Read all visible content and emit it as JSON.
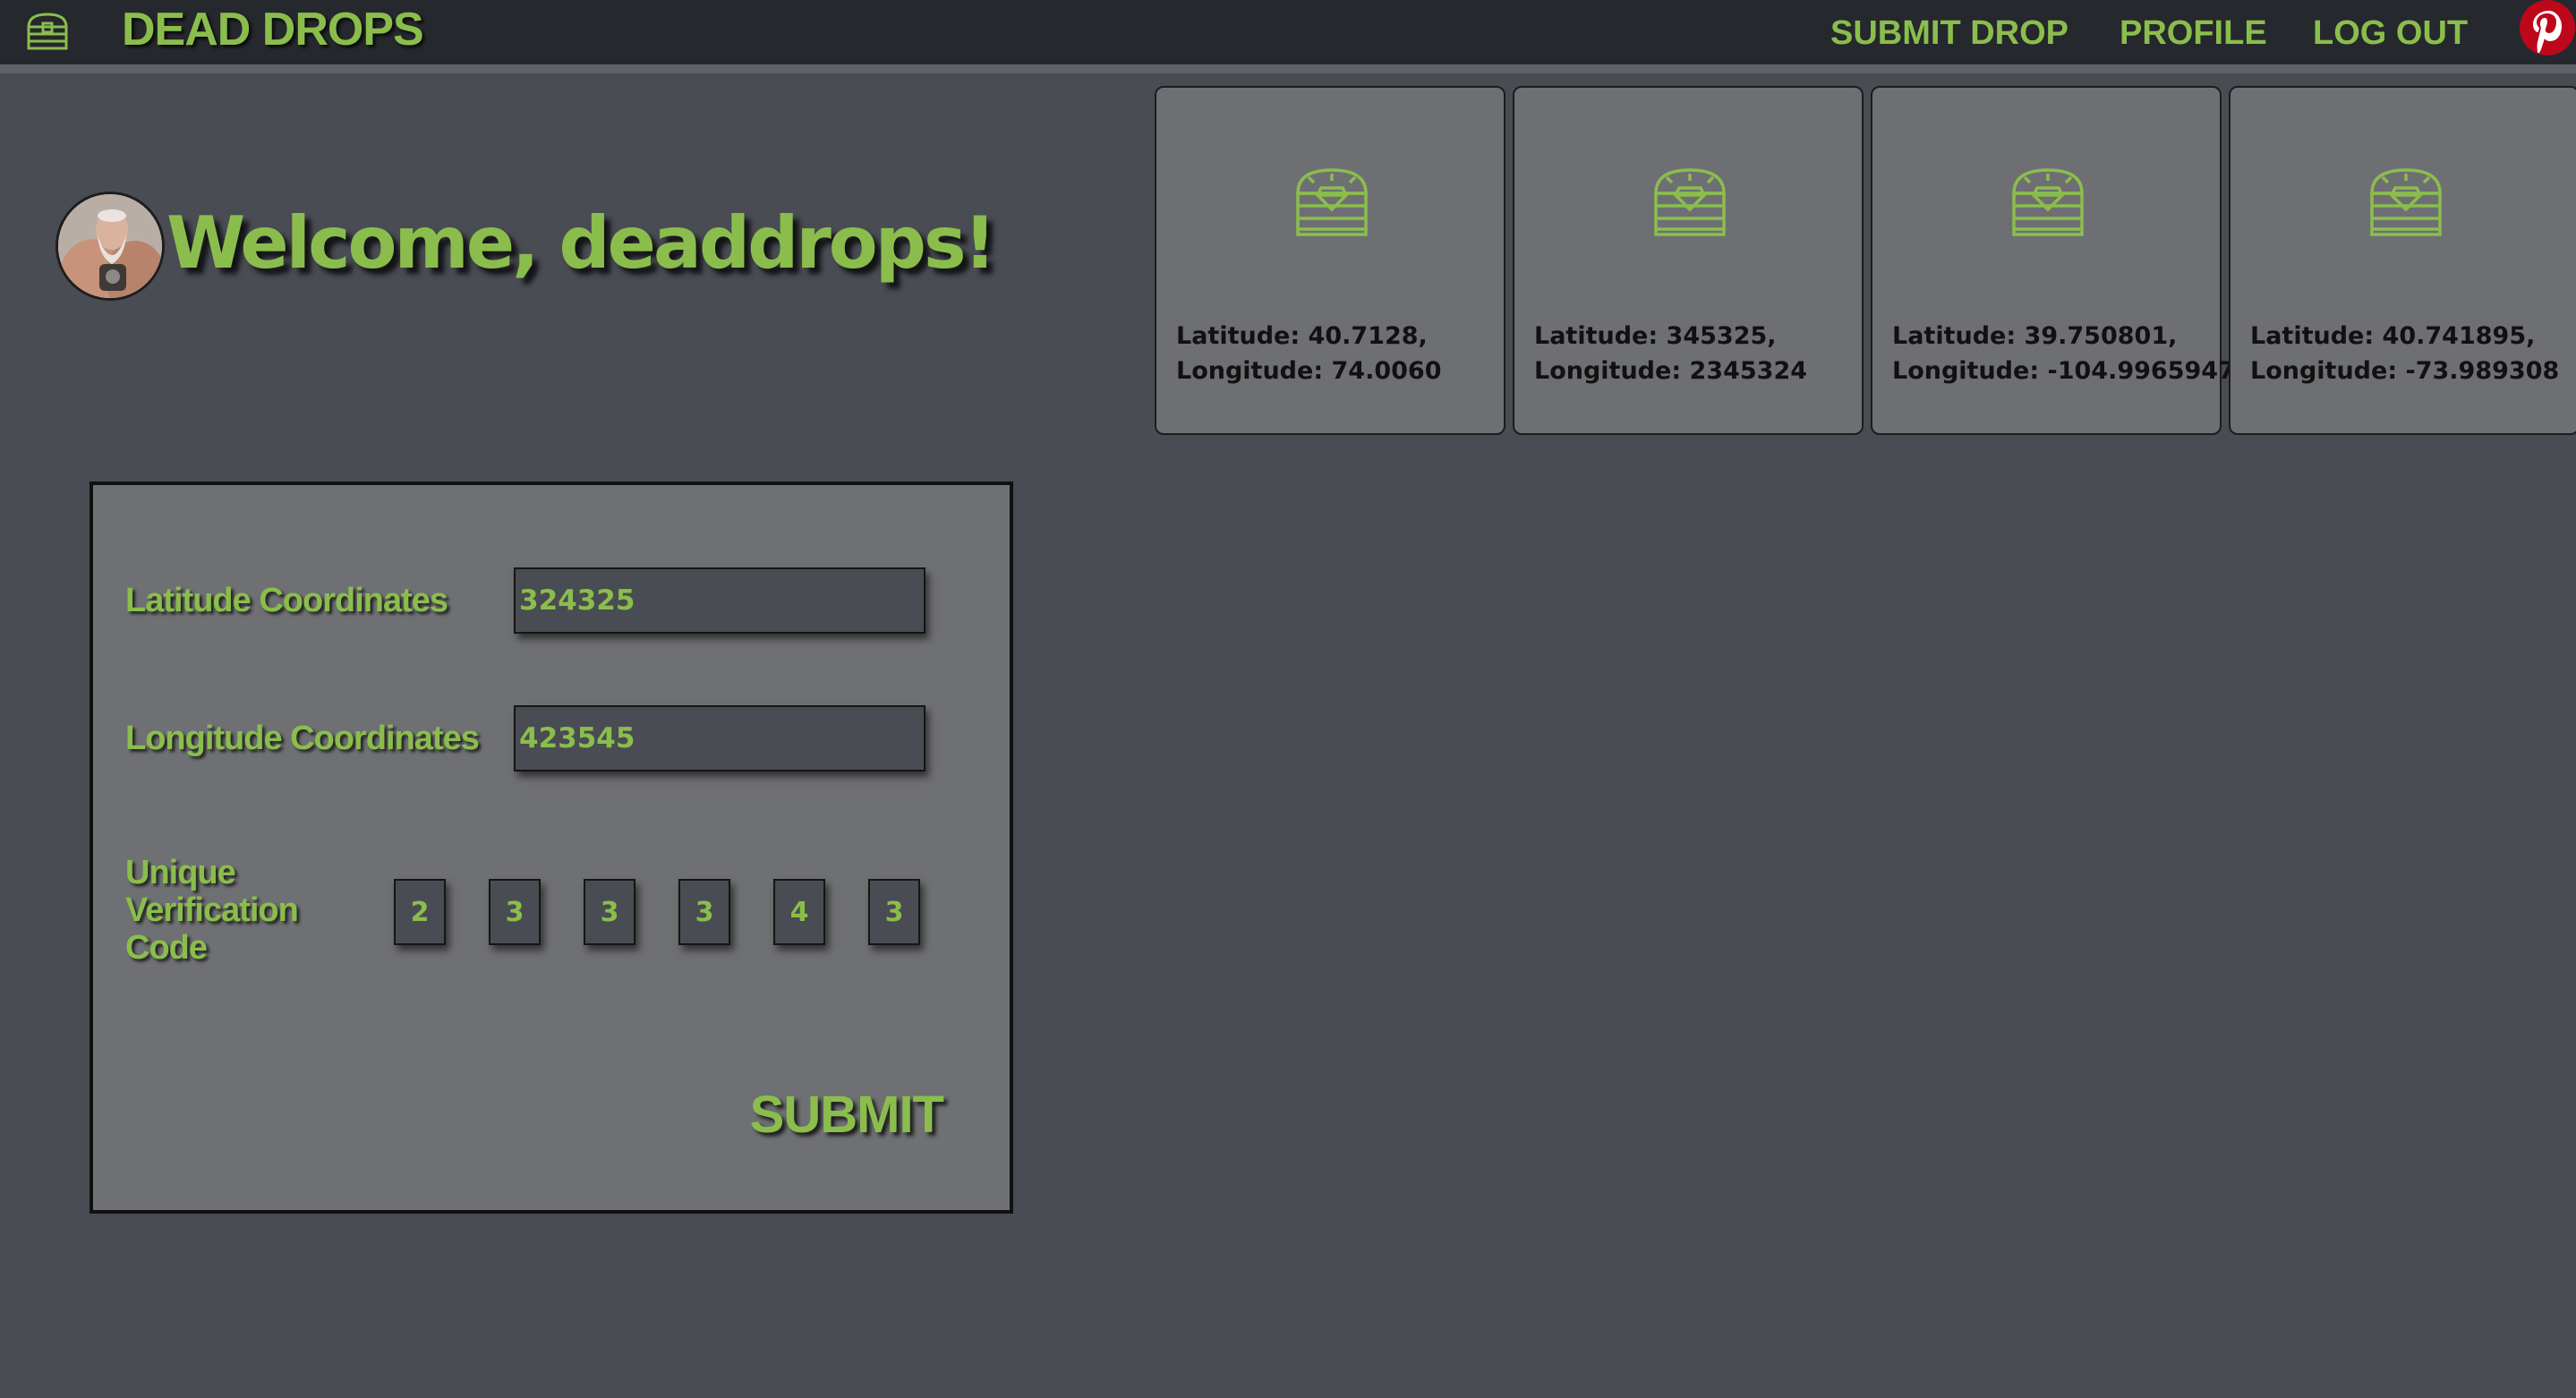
{
  "nav": {
    "brand": "DEAD DROPS",
    "submit_drop": "SUBMIT DROP",
    "profile": "PROFILE",
    "log_out": "LOG OUT",
    "logo_icon": "treasure-chest-icon",
    "social_icon": "pinterest-icon"
  },
  "welcome": {
    "text": "Welcome, deaddrops!",
    "avatar": "user-avatar"
  },
  "drops": [
    {
      "icon": "treasure-chest-icon",
      "line1": "Latitude: 40.7128,",
      "line2": "Longitude: 74.0060"
    },
    {
      "icon": "treasure-chest-icon",
      "line1": "Latitude: 345325,",
      "line2": "Longitude: 2345324"
    },
    {
      "icon": "treasure-chest-icon",
      "line1": "Latitude: 39.750801,",
      "line2": "Longitude: -104.9965947"
    },
    {
      "icon": "treasure-chest-icon",
      "line1": "Latitude: 40.741895,",
      "line2": "Longitude: -73.989308"
    }
  ],
  "form": {
    "latitude_label": "Latitude Coordinates",
    "latitude_value": "324325",
    "longitude_label": "Longitude Coordinates",
    "longitude_value": "423545",
    "code_label": "Unique Verification Code",
    "code_digits": [
      "2",
      "3",
      "3",
      "3",
      "4",
      "3"
    ],
    "submit_label": "SUBMIT"
  },
  "colors": {
    "accent_green": "#8bbd4d",
    "navbar_bg": "#25282c",
    "page_bg": "#494c53",
    "panel_bg": "#6f7073",
    "pinterest_red": "#bd081c"
  }
}
